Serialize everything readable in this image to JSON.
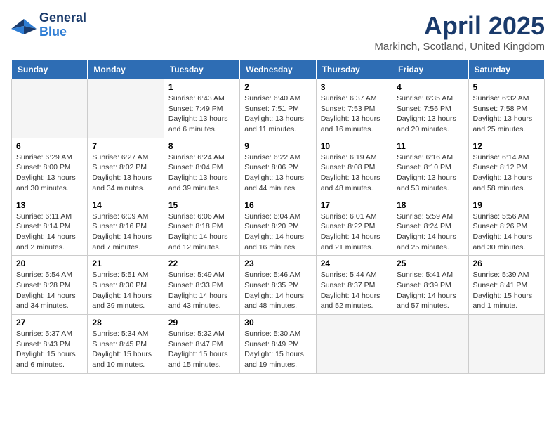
{
  "header": {
    "logo_general": "General",
    "logo_blue": "Blue",
    "month_title": "April 2025",
    "location": "Markinch, Scotland, United Kingdom"
  },
  "days_of_week": [
    "Sunday",
    "Monday",
    "Tuesday",
    "Wednesday",
    "Thursday",
    "Friday",
    "Saturday"
  ],
  "weeks": [
    [
      {
        "day": "",
        "info": ""
      },
      {
        "day": "",
        "info": ""
      },
      {
        "day": "1",
        "info": "Sunrise: 6:43 AM\nSunset: 7:49 PM\nDaylight: 13 hours and 6 minutes."
      },
      {
        "day": "2",
        "info": "Sunrise: 6:40 AM\nSunset: 7:51 PM\nDaylight: 13 hours and 11 minutes."
      },
      {
        "day": "3",
        "info": "Sunrise: 6:37 AM\nSunset: 7:53 PM\nDaylight: 13 hours and 16 minutes."
      },
      {
        "day": "4",
        "info": "Sunrise: 6:35 AM\nSunset: 7:56 PM\nDaylight: 13 hours and 20 minutes."
      },
      {
        "day": "5",
        "info": "Sunrise: 6:32 AM\nSunset: 7:58 PM\nDaylight: 13 hours and 25 minutes."
      }
    ],
    [
      {
        "day": "6",
        "info": "Sunrise: 6:29 AM\nSunset: 8:00 PM\nDaylight: 13 hours and 30 minutes."
      },
      {
        "day": "7",
        "info": "Sunrise: 6:27 AM\nSunset: 8:02 PM\nDaylight: 13 hours and 34 minutes."
      },
      {
        "day": "8",
        "info": "Sunrise: 6:24 AM\nSunset: 8:04 PM\nDaylight: 13 hours and 39 minutes."
      },
      {
        "day": "9",
        "info": "Sunrise: 6:22 AM\nSunset: 8:06 PM\nDaylight: 13 hours and 44 minutes."
      },
      {
        "day": "10",
        "info": "Sunrise: 6:19 AM\nSunset: 8:08 PM\nDaylight: 13 hours and 48 minutes."
      },
      {
        "day": "11",
        "info": "Sunrise: 6:16 AM\nSunset: 8:10 PM\nDaylight: 13 hours and 53 minutes."
      },
      {
        "day": "12",
        "info": "Sunrise: 6:14 AM\nSunset: 8:12 PM\nDaylight: 13 hours and 58 minutes."
      }
    ],
    [
      {
        "day": "13",
        "info": "Sunrise: 6:11 AM\nSunset: 8:14 PM\nDaylight: 14 hours and 2 minutes."
      },
      {
        "day": "14",
        "info": "Sunrise: 6:09 AM\nSunset: 8:16 PM\nDaylight: 14 hours and 7 minutes."
      },
      {
        "day": "15",
        "info": "Sunrise: 6:06 AM\nSunset: 8:18 PM\nDaylight: 14 hours and 12 minutes."
      },
      {
        "day": "16",
        "info": "Sunrise: 6:04 AM\nSunset: 8:20 PM\nDaylight: 14 hours and 16 minutes."
      },
      {
        "day": "17",
        "info": "Sunrise: 6:01 AM\nSunset: 8:22 PM\nDaylight: 14 hours and 21 minutes."
      },
      {
        "day": "18",
        "info": "Sunrise: 5:59 AM\nSunset: 8:24 PM\nDaylight: 14 hours and 25 minutes."
      },
      {
        "day": "19",
        "info": "Sunrise: 5:56 AM\nSunset: 8:26 PM\nDaylight: 14 hours and 30 minutes."
      }
    ],
    [
      {
        "day": "20",
        "info": "Sunrise: 5:54 AM\nSunset: 8:28 PM\nDaylight: 14 hours and 34 minutes."
      },
      {
        "day": "21",
        "info": "Sunrise: 5:51 AM\nSunset: 8:30 PM\nDaylight: 14 hours and 39 minutes."
      },
      {
        "day": "22",
        "info": "Sunrise: 5:49 AM\nSunset: 8:33 PM\nDaylight: 14 hours and 43 minutes."
      },
      {
        "day": "23",
        "info": "Sunrise: 5:46 AM\nSunset: 8:35 PM\nDaylight: 14 hours and 48 minutes."
      },
      {
        "day": "24",
        "info": "Sunrise: 5:44 AM\nSunset: 8:37 PM\nDaylight: 14 hours and 52 minutes."
      },
      {
        "day": "25",
        "info": "Sunrise: 5:41 AM\nSunset: 8:39 PM\nDaylight: 14 hours and 57 minutes."
      },
      {
        "day": "26",
        "info": "Sunrise: 5:39 AM\nSunset: 8:41 PM\nDaylight: 15 hours and 1 minute."
      }
    ],
    [
      {
        "day": "27",
        "info": "Sunrise: 5:37 AM\nSunset: 8:43 PM\nDaylight: 15 hours and 6 minutes."
      },
      {
        "day": "28",
        "info": "Sunrise: 5:34 AM\nSunset: 8:45 PM\nDaylight: 15 hours and 10 minutes."
      },
      {
        "day": "29",
        "info": "Sunrise: 5:32 AM\nSunset: 8:47 PM\nDaylight: 15 hours and 15 minutes."
      },
      {
        "day": "30",
        "info": "Sunrise: 5:30 AM\nSunset: 8:49 PM\nDaylight: 15 hours and 19 minutes."
      },
      {
        "day": "",
        "info": ""
      },
      {
        "day": "",
        "info": ""
      },
      {
        "day": "",
        "info": ""
      }
    ]
  ]
}
